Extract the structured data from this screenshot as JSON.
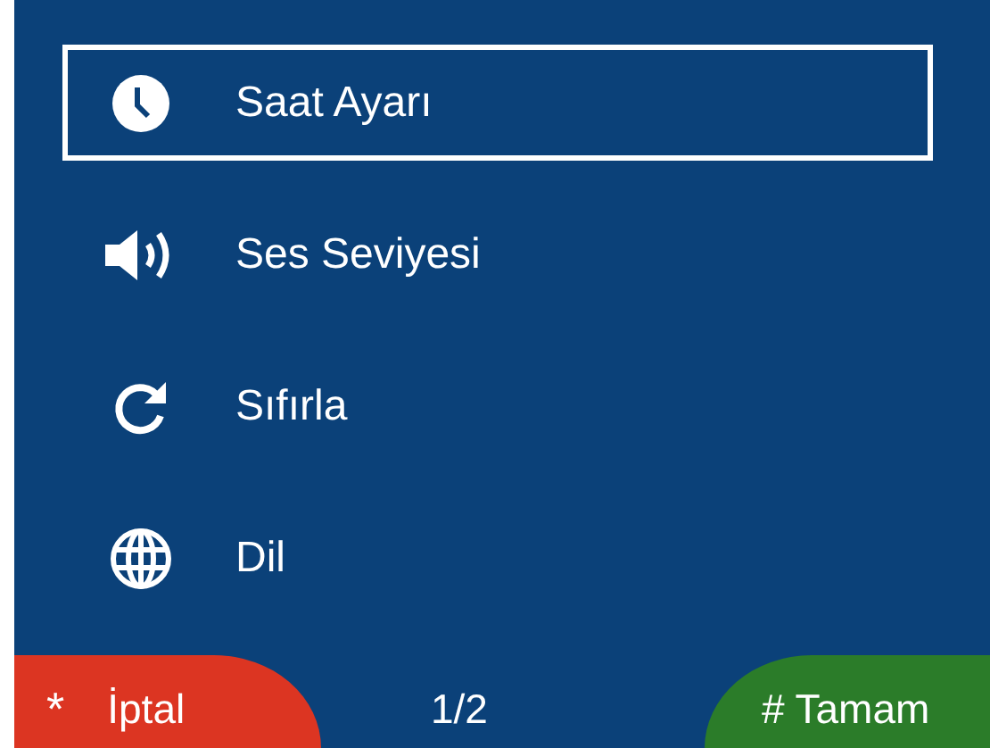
{
  "menu": [
    {
      "kind": "clock",
      "label": "Saat Ayarı",
      "selected": true
    },
    {
      "kind": "speaker",
      "label": "Ses Seviyesi",
      "selected": false
    },
    {
      "kind": "refresh",
      "label": "Sıfırla",
      "selected": false
    },
    {
      "kind": "globe",
      "label": "Dil",
      "selected": false
    }
  ],
  "footer": {
    "cancel": {
      "key": "*",
      "label": "İptal"
    },
    "page": "1/2",
    "ok": {
      "key": "#",
      "label": "Tamam"
    }
  }
}
